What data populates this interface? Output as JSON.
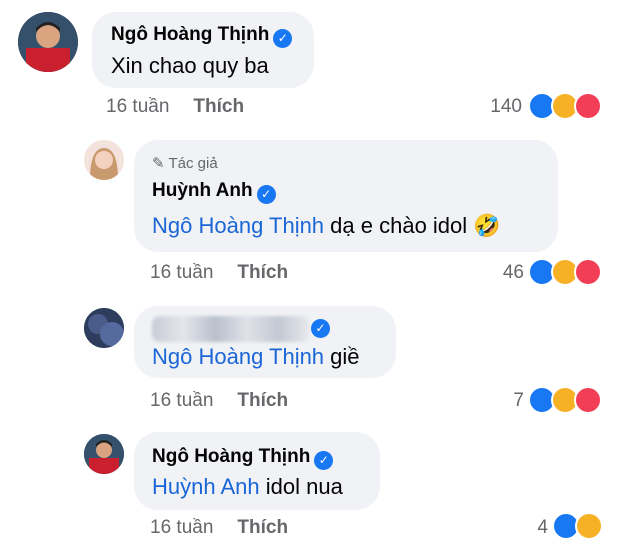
{
  "comments": [
    {
      "author": "Ngô Hoàng Thịnh",
      "mention": "",
      "text": "Xin chao quy ba",
      "time": "16 tuần",
      "like_label": "Thích",
      "reaction_count": "140",
      "reactions": [
        "like-icon",
        "haha-icon",
        "love-icon"
      ]
    },
    {
      "author_tag": "Tác giả",
      "author": "Huỳnh Anh",
      "mention": "Ngô Hoàng Thịnh",
      "text": "dạ e chào idol",
      "emoji": "🤣",
      "time": "16 tuần",
      "like_label": "Thích",
      "reaction_count": "46",
      "reactions": [
        "like-icon",
        "haha-icon",
        "love-icon"
      ]
    },
    {
      "author": "",
      "mention": "Ngô Hoàng Thịnh",
      "text": "giề",
      "time": "16 tuần",
      "like_label": "Thích",
      "reaction_count": "7",
      "reactions": [
        "like-icon",
        "haha-icon",
        "love-icon"
      ]
    },
    {
      "author": "Ngô Hoàng Thịnh",
      "mention": "Huỳnh Anh",
      "text": "idol nua",
      "time": "16 tuần",
      "like_label": "Thích",
      "reaction_count": "4",
      "reactions": [
        "like-icon",
        "haha-icon"
      ]
    }
  ],
  "colors": {
    "bubble": "#f0f2f5",
    "mention": "#1b66d6",
    "meta": "#65676b",
    "verified": "#1877f2"
  }
}
